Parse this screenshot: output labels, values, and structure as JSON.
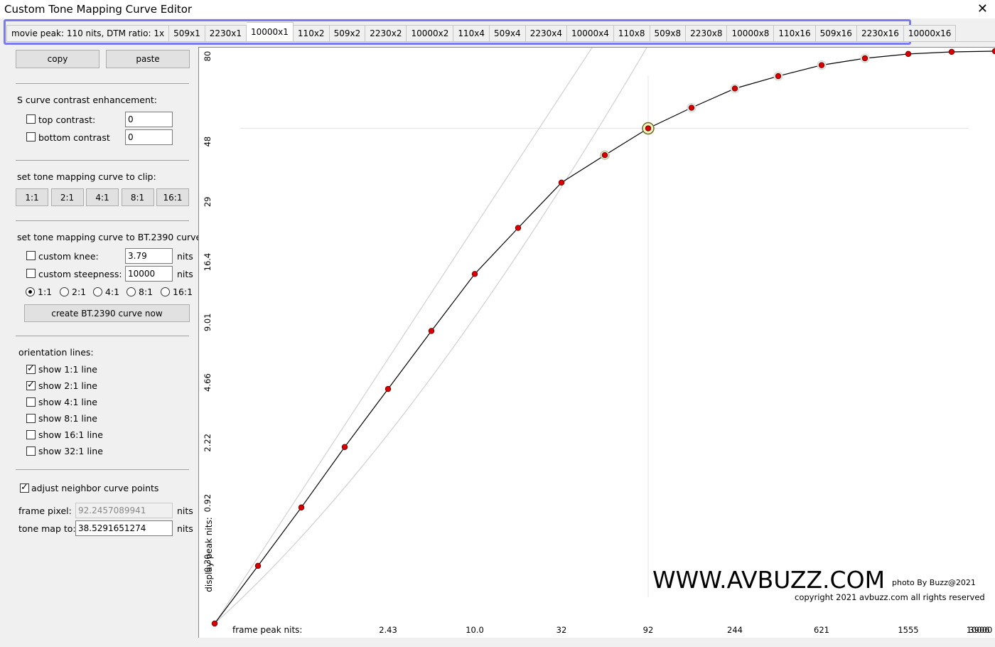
{
  "window": {
    "title": "Custom Tone Mapping Curve Editor",
    "close": "✕"
  },
  "tabs": [
    "movie peak: 110 nits, DTM ratio: 1x",
    "509x1",
    "2230x1",
    "10000x1",
    "110x2",
    "509x2",
    "2230x2",
    "10000x2",
    "110x4",
    "509x4",
    "2230x4",
    "10000x4",
    "110x8",
    "509x8",
    "2230x8",
    "10000x8",
    "110x16",
    "509x16",
    "2230x16",
    "10000x16"
  ],
  "active_tab": "10000x1",
  "panel": {
    "copy": "copy",
    "paste": "paste",
    "s_curve": {
      "heading": "S curve contrast enhancement:",
      "top_label": "top contrast:",
      "top_value": "0",
      "top_checked": false,
      "bottom_label": "bottom contrast",
      "bottom_value": "0",
      "bottom_checked": false
    },
    "clip": {
      "heading": "set tone mapping curve to clip:",
      "buttons": [
        "1:1",
        "2:1",
        "4:1",
        "8:1",
        "16:1"
      ]
    },
    "bt2390": {
      "heading": "set tone mapping curve to BT.2390 curve:",
      "knee_label": "custom knee:",
      "knee_value": "3.79",
      "knee_unit": "nits",
      "knee_checked": false,
      "steep_label": "custom steepness:",
      "steep_value": "10000",
      "steep_unit": "nits",
      "steep_checked": false,
      "radios": [
        "1:1",
        "2:1",
        "4:1",
        "8:1",
        "16:1"
      ],
      "radio_selected": "1:1",
      "create": "create BT.2390 curve now"
    },
    "orientation": {
      "heading": "orientation lines:",
      "items": [
        {
          "label": "show 1:1 line",
          "checked": true
        },
        {
          "label": "show 2:1 line",
          "checked": true
        },
        {
          "label": "show 4:1 line",
          "checked": false
        },
        {
          "label": "show 8:1 line",
          "checked": false
        },
        {
          "label": "show 16:1 line",
          "checked": false
        },
        {
          "label": "show 32:1 line",
          "checked": false
        }
      ]
    },
    "adjust": {
      "label": "adjust neighbor curve points",
      "checked": true
    },
    "frame_pixel": {
      "label": "frame pixel:",
      "value": "92.2457089941",
      "unit": "nits"
    },
    "tone_map": {
      "label": "tone map to:",
      "value": "38.5291651274",
      "unit": "nits"
    }
  },
  "plot": {
    "y_axis_label": "display peak nits:",
    "x_axis_label": "frame peak nits:",
    "y_ticks": [
      "0.30",
      "0.92",
      "2.22",
      "4.66",
      "9.01",
      "16.4",
      "29",
      "48",
      "80"
    ],
    "x_ticks": [
      "2.43",
      "10.0",
      "32",
      "92",
      "244",
      "621",
      "1555",
      "3906",
      "10000"
    ],
    "watermark": "WWW.AVBUZZ.COM",
    "photo_credit": "photo By Buzz@2021",
    "copyright": "copyright 2021 avbuzz.com all rights reserved",
    "curve_points": [
      {
        "pos": 0.0,
        "level": 0.0
      },
      {
        "pos": 0.0625,
        "level": 0.1008
      },
      {
        "pos": 0.125,
        "level": 0.2028
      },
      {
        "pos": 0.1875,
        "level": 0.3084
      },
      {
        "pos": 0.25,
        "level": 0.4098
      },
      {
        "pos": 0.3125,
        "level": 0.5112
      },
      {
        "pos": 0.375,
        "level": 0.6108
      },
      {
        "pos": 0.4375,
        "level": 0.6912
      },
      {
        "pos": 0.5,
        "level": 0.7704
      },
      {
        "pos": 0.5625,
        "level": 0.8184
      },
      {
        "pos": 0.625,
        "level": 0.8652
      },
      {
        "pos": 0.6875,
        "level": 0.9012
      },
      {
        "pos": 0.75,
        "level": 0.9348
      },
      {
        "pos": 0.8125,
        "level": 0.9564
      },
      {
        "pos": 0.875,
        "level": 0.9756
      },
      {
        "pos": 0.9375,
        "level": 0.9876
      },
      {
        "pos": 1.0,
        "level": 0.9952
      },
      {
        "pos": 1.0625,
        "level": 0.9988
      },
      {
        "pos": 1.125,
        "level": 1.0
      }
    ],
    "highlight_points": [
      0.5625
    ],
    "selected_point": 0.625,
    "crosshair_pos": 0.625,
    "crosshair_level": 0.8652
  }
}
